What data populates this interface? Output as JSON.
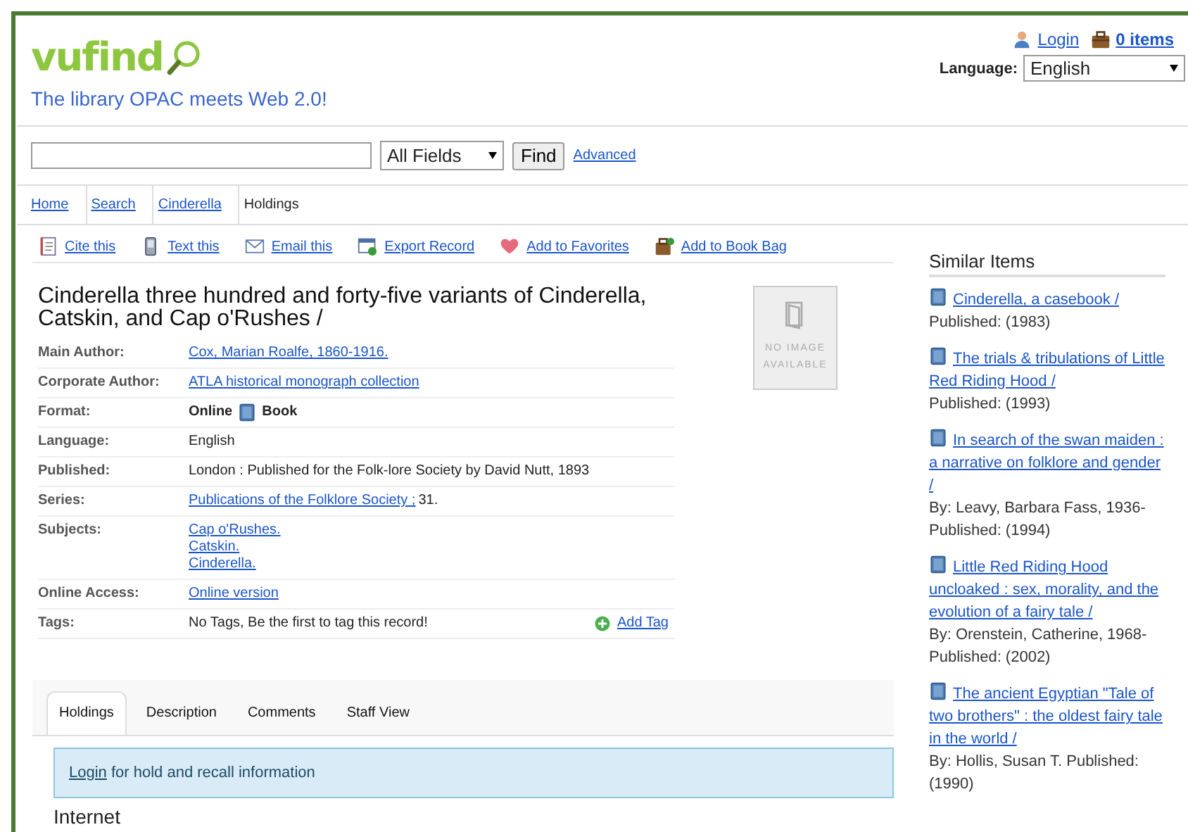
{
  "header": {
    "logo": "vufind",
    "tagline": "The library OPAC meets Web 2.0!",
    "login": "Login",
    "cart": "0 items",
    "language_label": "Language:",
    "language": "English"
  },
  "search": {
    "type": "All Fields",
    "button": "Find",
    "advanced": "Advanced"
  },
  "breadcrumb": [
    {
      "label": "Home",
      "link": true
    },
    {
      "label": "Search",
      "link": true
    },
    {
      "label": "Cinderella",
      "link": true
    },
    {
      "label": "Holdings",
      "link": false
    }
  ],
  "actions": [
    "Cite this",
    "Text this",
    "Email this",
    "Export Record",
    "Add to Favorites",
    "Add to Book Bag"
  ],
  "record": {
    "title": "Cinderella three hundred and forty-five variants of Cinderella, Catskin, and Cap o'Rushes /",
    "cover": "NO IMAGE AVAILABLE",
    "fields": [
      {
        "label": "Main Author:",
        "kind": "links",
        "values": [
          "Cox, Marian Roalfe, 1860-1916."
        ]
      },
      {
        "label": "Corporate Author:",
        "kind": "links",
        "values": [
          "ATLA historical monograph collection"
        ]
      },
      {
        "label": "Format:",
        "kind": "format",
        "values": [
          "Online",
          "Book"
        ]
      },
      {
        "label": "Language:",
        "kind": "text",
        "values": [
          "English"
        ]
      },
      {
        "label": "Published:",
        "kind": "text",
        "values": [
          "London : Published for the Folk-lore Society by David Nutt, 1893"
        ]
      },
      {
        "label": "Series:",
        "kind": "series",
        "values": [
          "Publications of the Folklore Society ;",
          "31."
        ]
      },
      {
        "label": "Subjects:",
        "kind": "links",
        "values": [
          "Cap o'Rushes.",
          "Catskin.",
          "Cinderella."
        ]
      },
      {
        "label": "Online Access:",
        "kind": "links",
        "values": [
          "Online version"
        ]
      },
      {
        "label": "Tags:",
        "kind": "tags",
        "values": [
          "No Tags, Be the first to tag this record!",
          "Add Tag"
        ]
      }
    ]
  },
  "tabs": [
    {
      "label": "Holdings",
      "selected": true
    },
    {
      "label": "Description",
      "selected": false
    },
    {
      "label": "Comments",
      "selected": false
    },
    {
      "label": "Staff View",
      "selected": false
    }
  ],
  "notice": {
    "link": "Login",
    "text": "for hold and recall information"
  },
  "section_heading": "Internet",
  "similar": {
    "title": "Similar Items",
    "items": [
      {
        "title": "Cinderella, a casebook /",
        "lines": [
          "Published: (1983)"
        ]
      },
      {
        "title": "The trials & tribulations of Little Red Riding Hood /",
        "lines": [
          "Published: (1993)"
        ]
      },
      {
        "title": "In search of the swan maiden : a narrative on folklore and gender /",
        "lines": [
          "By: Leavy, Barbara Fass, 1936-",
          "Published: (1994)"
        ]
      },
      {
        "title": "Little Red Riding Hood uncloaked : sex, morality, and the evolution of a fairy tale /",
        "lines": [
          "By: Orenstein, Catherine, 1968-",
          "Published: (2002)"
        ]
      },
      {
        "title": "The ancient Egyptian \"Tale of two brothers\" : the oldest fairy tale in the world /",
        "lines": [
          "By: Hollis, Susan T. Published: (1990)"
        ]
      }
    ]
  }
}
